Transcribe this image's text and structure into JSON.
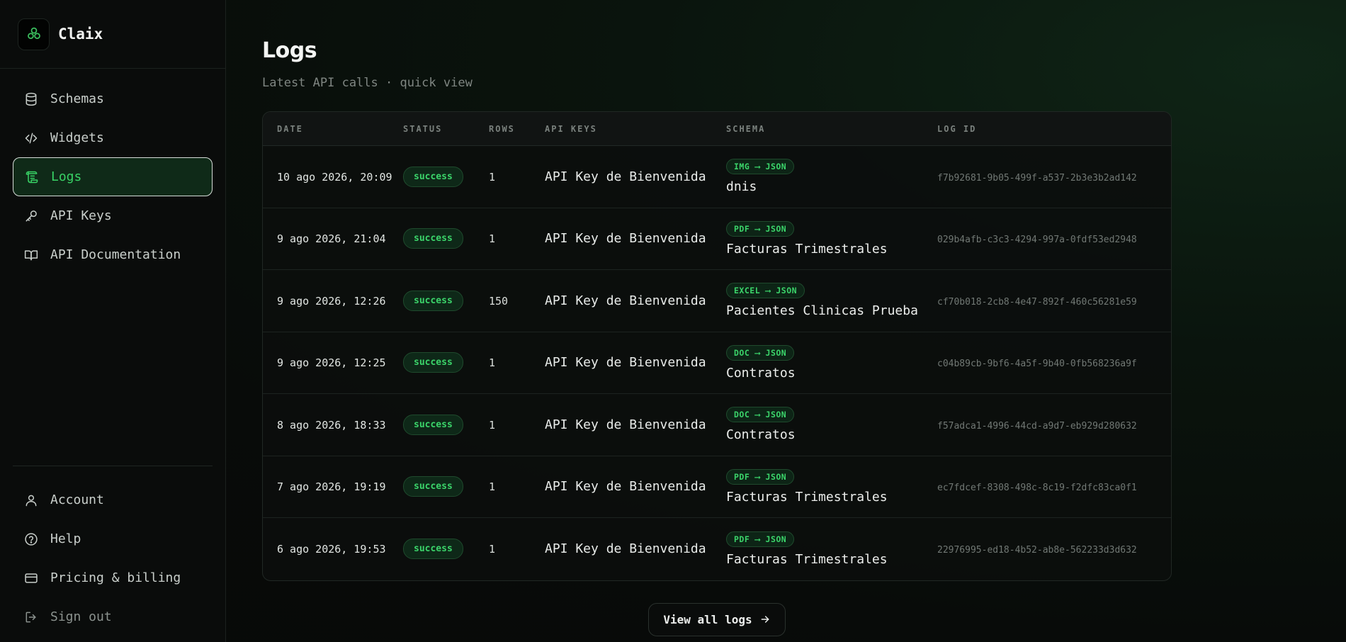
{
  "brand": {
    "name": "Claix"
  },
  "nav": {
    "items": [
      {
        "label": "Schemas",
        "icon": "database-icon"
      },
      {
        "label": "Widgets",
        "icon": "code-icon"
      },
      {
        "label": "Logs",
        "icon": "scroll-icon",
        "active": true
      },
      {
        "label": "API Keys",
        "icon": "key-icon"
      },
      {
        "label": "API Documentation",
        "icon": "book-icon"
      }
    ],
    "bottom": [
      {
        "label": "Account",
        "icon": "user-icon"
      },
      {
        "label": "Help",
        "icon": "help-icon"
      },
      {
        "label": "Pricing & billing",
        "icon": "credit-card-icon"
      },
      {
        "label": "Sign out",
        "icon": "sign-out-icon"
      }
    ]
  },
  "page": {
    "title": "Logs",
    "subtitle": "Latest API calls · quick view"
  },
  "table": {
    "headers": {
      "date": "DATE",
      "status": "STATUS",
      "rows": "ROWS",
      "api_keys": "API KEYS",
      "schema": "SCHEMA",
      "log_id": "LOG ID"
    },
    "rows": [
      {
        "date": "10 ago 2026, 20:09",
        "status": "success",
        "rows": "1",
        "api_key": "API Key de Bienvenida",
        "schema_tag": "IMG ⟶ JSON",
        "schema_name": "dnis",
        "log_id": "f7b92681-9b05-499f-a537-2b3e3b2ad142"
      },
      {
        "date": "9 ago 2026, 21:04",
        "status": "success",
        "rows": "1",
        "api_key": "API Key de Bienvenida",
        "schema_tag": "PDF ⟶ JSON",
        "schema_name": "Facturas Trimestrales",
        "log_id": "029b4afb-c3c3-4294-997a-0fdf53ed2948"
      },
      {
        "date": "9 ago 2026, 12:26",
        "status": "success",
        "rows": "150",
        "api_key": "API Key de Bienvenida",
        "schema_tag": "EXCEL ⟶ JSON",
        "schema_name": "Pacientes Clinicas Prueba",
        "log_id": "cf70b018-2cb8-4e47-892f-460c56281e59"
      },
      {
        "date": "9 ago 2026, 12:25",
        "status": "success",
        "rows": "1",
        "api_key": "API Key de Bienvenida",
        "schema_tag": "DOC ⟶ JSON",
        "schema_name": "Contratos",
        "log_id": "c04b89cb-9bf6-4a5f-9b40-0fb568236a9f"
      },
      {
        "date": "8 ago 2026, 18:33",
        "status": "success",
        "rows": "1",
        "api_key": "API Key de Bienvenida",
        "schema_tag": "DOC ⟶ JSON",
        "schema_name": "Contratos",
        "log_id": "f57adca1-4996-44cd-a9d7-eb929d280632"
      },
      {
        "date": "7 ago 2026, 19:19",
        "status": "success",
        "rows": "1",
        "api_key": "API Key de Bienvenida",
        "schema_tag": "PDF ⟶ JSON",
        "schema_name": "Facturas Trimestrales",
        "log_id": "ec7fdcef-8308-498c-8c19-f2dfc83ca0f1"
      },
      {
        "date": "6 ago 2026, 19:53",
        "status": "success",
        "rows": "1",
        "api_key": "API Key de Bienvenida",
        "schema_tag": "PDF ⟶ JSON",
        "schema_name": "Facturas Trimestrales",
        "log_id": "22976995-ed18-4b52-ab8e-562233d3d632"
      }
    ]
  },
  "view_all": {
    "label": "View all logs",
    "icon": "arrow-right-icon"
  },
  "colors": {
    "accent": "#38d265",
    "background": "#080b09",
    "sidebar": "#0a0c0b"
  }
}
